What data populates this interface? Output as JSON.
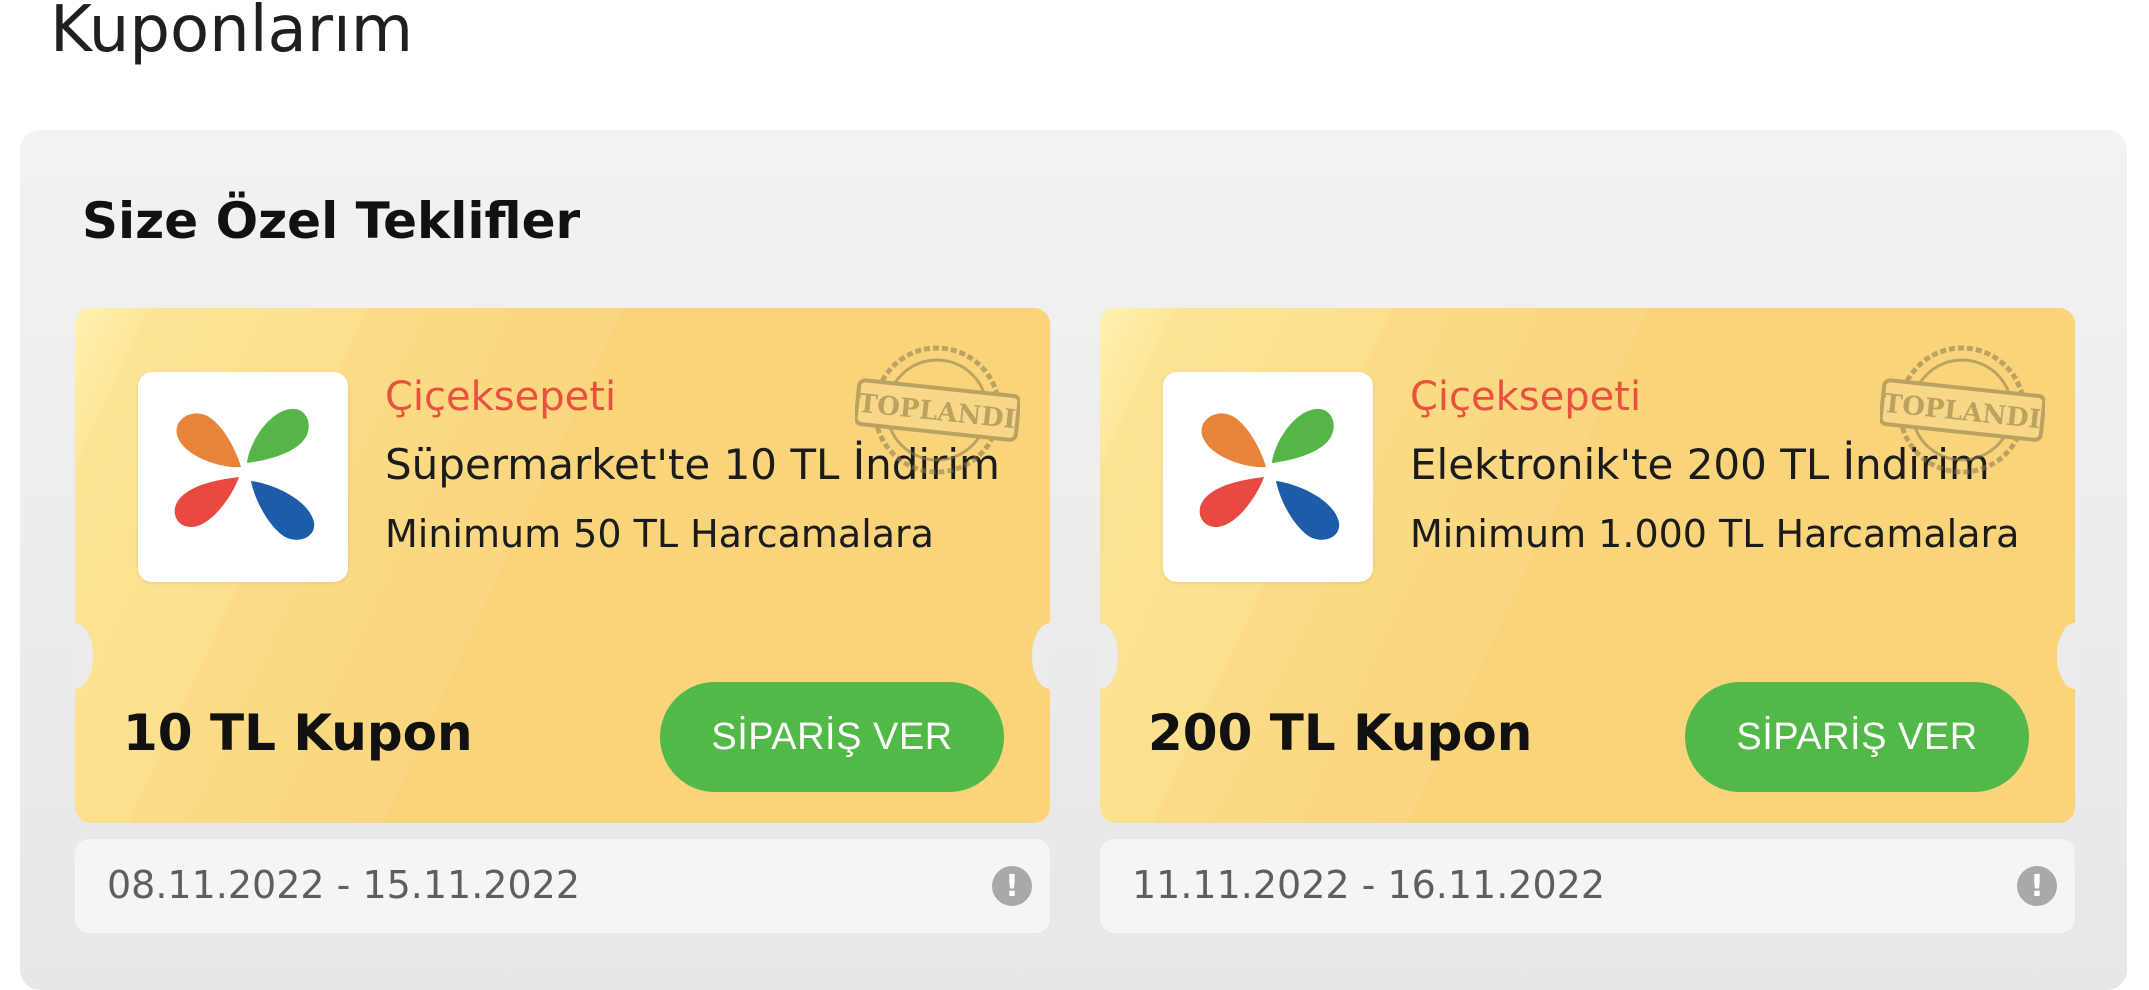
{
  "page": {
    "title": "Kuponlarım"
  },
  "section": {
    "title": "Size Özel Teklifler"
  },
  "coupons": [
    {
      "brand": "Çiçeksepeti",
      "offer": "Süpermarket'te 10 TL İndirim",
      "minimum": "Minimum 50 TL Harcamalara",
      "amount": "10 TL Kupon",
      "button_label": "SİPARİŞ VER",
      "stamp_text": "TOPLANDI",
      "date_range": "08.11.2022 - 15.11.2022",
      "info_icon": "info-icon"
    },
    {
      "brand": "Çiçeksepeti",
      "offer": "Elektronik'te 200 TL İndirim",
      "minimum": "Minimum 1.000 TL Harcamalara",
      "amount": "200 TL Kupon",
      "button_label": "SİPARİŞ VER",
      "stamp_text": "TOPLANDI",
      "date_range": "11.11.2022 - 16.11.2022",
      "info_icon": "info-icon"
    }
  ],
  "colors": {
    "brand": "#e8513e",
    "button": "#52b848",
    "ticket": "#f9d47a"
  }
}
